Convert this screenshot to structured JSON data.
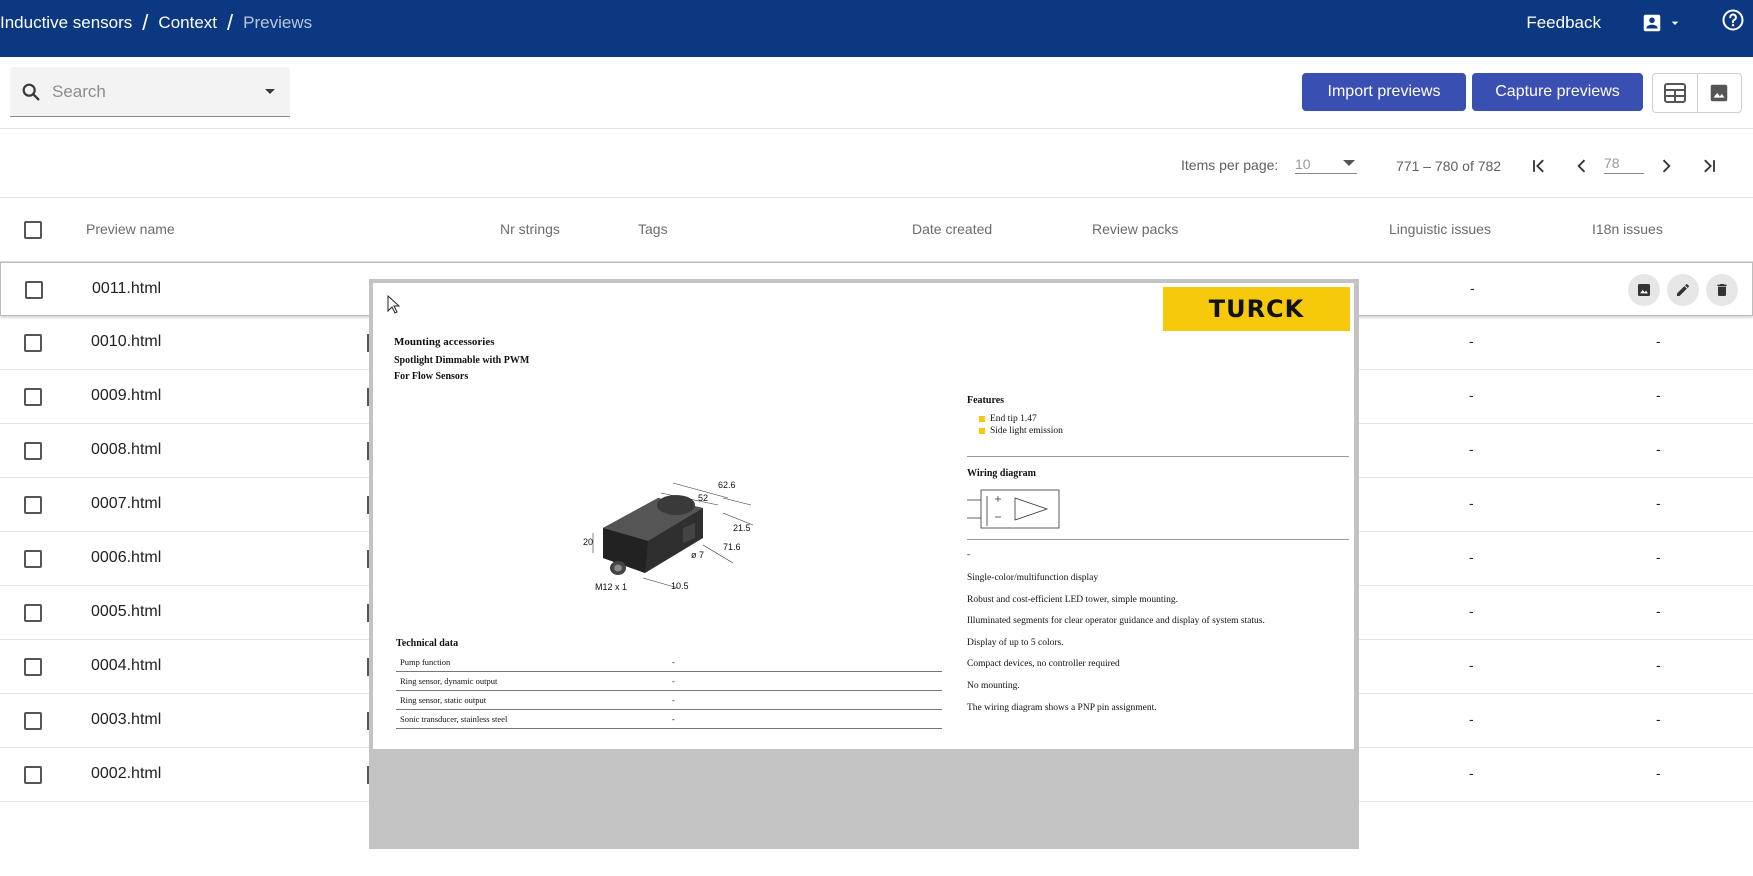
{
  "breadcrumb": {
    "items": [
      "Inductive sensors",
      "Context"
    ],
    "current": "Previews"
  },
  "header": {
    "feedback_label": "Feedback"
  },
  "search": {
    "placeholder": "Search"
  },
  "toolbar": {
    "import_label": "Import previews",
    "capture_label": "Capture previews"
  },
  "paginator": {
    "items_per_page_label": "Items per page:",
    "items_per_page_value": "10",
    "range_label": "771 – 780 of 782",
    "page_value": "78"
  },
  "table": {
    "headers": {
      "name": "Preview name",
      "strings": "Nr strings",
      "tags": "Tags",
      "date": "Date created",
      "review": "Review packs",
      "linguistic": "Linguistic issues",
      "i18n": "I18n issues"
    },
    "rows": [
      {
        "name": "0011.html",
        "linguistic": "-",
        "i18n": ""
      },
      {
        "name": "0010.html",
        "linguistic": "-",
        "i18n": "-"
      },
      {
        "name": "0009.html",
        "linguistic": "-",
        "i18n": "-"
      },
      {
        "name": "0008.html",
        "linguistic": "-",
        "i18n": "-"
      },
      {
        "name": "0007.html",
        "linguistic": "-",
        "i18n": "-"
      },
      {
        "name": "0006.html",
        "linguistic": "-",
        "i18n": "-"
      },
      {
        "name": "0005.html",
        "linguistic": "-",
        "i18n": "-"
      },
      {
        "name": "0004.html",
        "linguistic": "-",
        "i18n": "-"
      },
      {
        "name": "0003.html",
        "linguistic": "-",
        "i18n": "-"
      },
      {
        "name": "0002.html",
        "linguistic": "-",
        "i18n": "-"
      }
    ]
  },
  "preview": {
    "logo_text": "TURCK",
    "title": "Mounting accessories",
    "subtitle1": "Spotlight Dimmable with PWM",
    "subtitle2": "For Flow Sensors",
    "dimensions": {
      "d1": "62.6",
      "d2": "52",
      "d3": "20",
      "d4": "21.5",
      "d5": "ø 7",
      "d6": "71.6",
      "d7": "M12 x 1",
      "d8": "10.5"
    },
    "technical_heading": "Technical data",
    "technical_rows": [
      {
        "key": "Pump function",
        "value": "-"
      },
      {
        "key": "Ring sensor, dynamic output",
        "value": "-"
      },
      {
        "key": "Ring sensor, static output",
        "value": "-"
      },
      {
        "key": "Sonic transducer, stainless steel",
        "value": "-"
      }
    ],
    "features_heading": "Features",
    "features": [
      "End tip 1.47",
      "Side light emission"
    ],
    "wiring_heading": "Wiring diagram",
    "wiring_dash": "-",
    "notes": [
      "Single-color/multifunction display",
      "Robust and cost-efficient LED tower, simple mounting.",
      "Illuminated segments for clear operator guidance and display of system status.",
      "Display of up to 5 colors.",
      "Compact devices, no controller required",
      "No mounting.",
      "The wiring diagram shows a PNP pin assignment."
    ]
  },
  "colors": {
    "header_bg": "#0b3880",
    "button_bg": "#3a4fb2",
    "logo_bg": "#f7c90b"
  }
}
